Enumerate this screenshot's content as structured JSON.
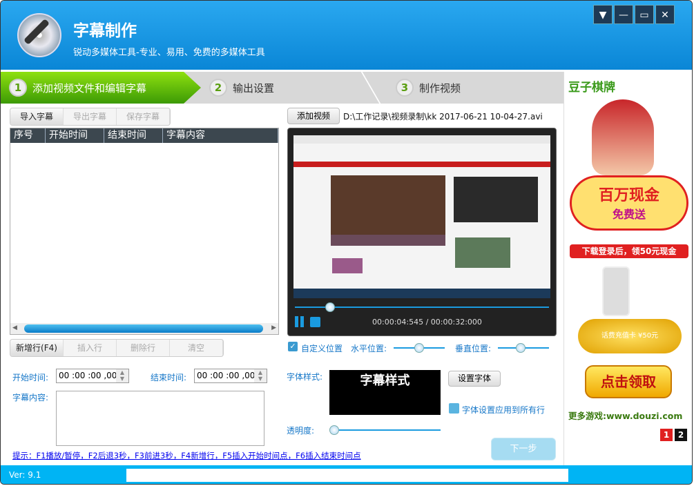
{
  "window": {
    "title": "字幕制作",
    "subtitle": "锐动多媒体工具-专业、易用、免费的多媒体工具",
    "controls": [
      "▼",
      "—",
      "▭",
      "✕"
    ]
  },
  "steps": [
    {
      "num": "1",
      "label": "添加视频文件和编辑字幕",
      "active": true
    },
    {
      "num": "2",
      "label": "输出设置"
    },
    {
      "num": "3",
      "label": "制作视频"
    }
  ],
  "subtitle_toolbar": {
    "import": "导入字幕",
    "export": "导出字幕",
    "save": "保存字幕"
  },
  "table": {
    "columns": [
      "序号",
      "开始时间",
      "结束时间",
      "字幕内容"
    ],
    "rows": []
  },
  "row_toolbar": {
    "add": "新增行(F4)",
    "insert": "插入行",
    "delete": "删除行",
    "clear": "清空"
  },
  "editor": {
    "start_label": "开始时间:",
    "start_value": "00 :00 :00 ,000",
    "end_label": "结束时间:",
    "end_value": "00 :00 :00 ,000",
    "content_label": "字幕内容:",
    "content_value": ""
  },
  "hint": "提示：F1播放/暂停，F2后退3秒，F3前进3秒，F4新增行，F5插入开始时间点，F6插入结束时间点",
  "video": {
    "add_button": "添加视频",
    "path": "D:\\工作记录\\视频录制\\kk 2017-06-21 10-04-27.avi",
    "time": "00:00:04:545 / 00:00:32:000",
    "progress": 0.14
  },
  "position": {
    "custom_label": "自定义位置",
    "custom_checked": true,
    "horizontal_label": "水平位置:",
    "horizontal": 0.5,
    "vertical_label": "垂直位置:",
    "vertical": 0.45
  },
  "font": {
    "label": "字体样式:",
    "preview": "字幕样式",
    "set_button": "设置字体",
    "apply_all_label": "字体设置应用到所有行",
    "apply_all_checked": false,
    "opacity_label": "透明度:",
    "opacity": 0
  },
  "next_button": "下一步",
  "status": {
    "version": "Ver: 9.1"
  },
  "ad": {
    "brand": "豆子棋牌",
    "banner": "百万现金",
    "banner2": "免费送",
    "promo": "下载登录后，领50元现金",
    "card": "话费充值卡 ¥50元",
    "cta": "点击领取",
    "more": "更多游戏:www.douzi.com",
    "pages": [
      "1",
      "2"
    ],
    "colors": {
      "accent": "#e02020",
      "gold": "#f5c200"
    }
  }
}
